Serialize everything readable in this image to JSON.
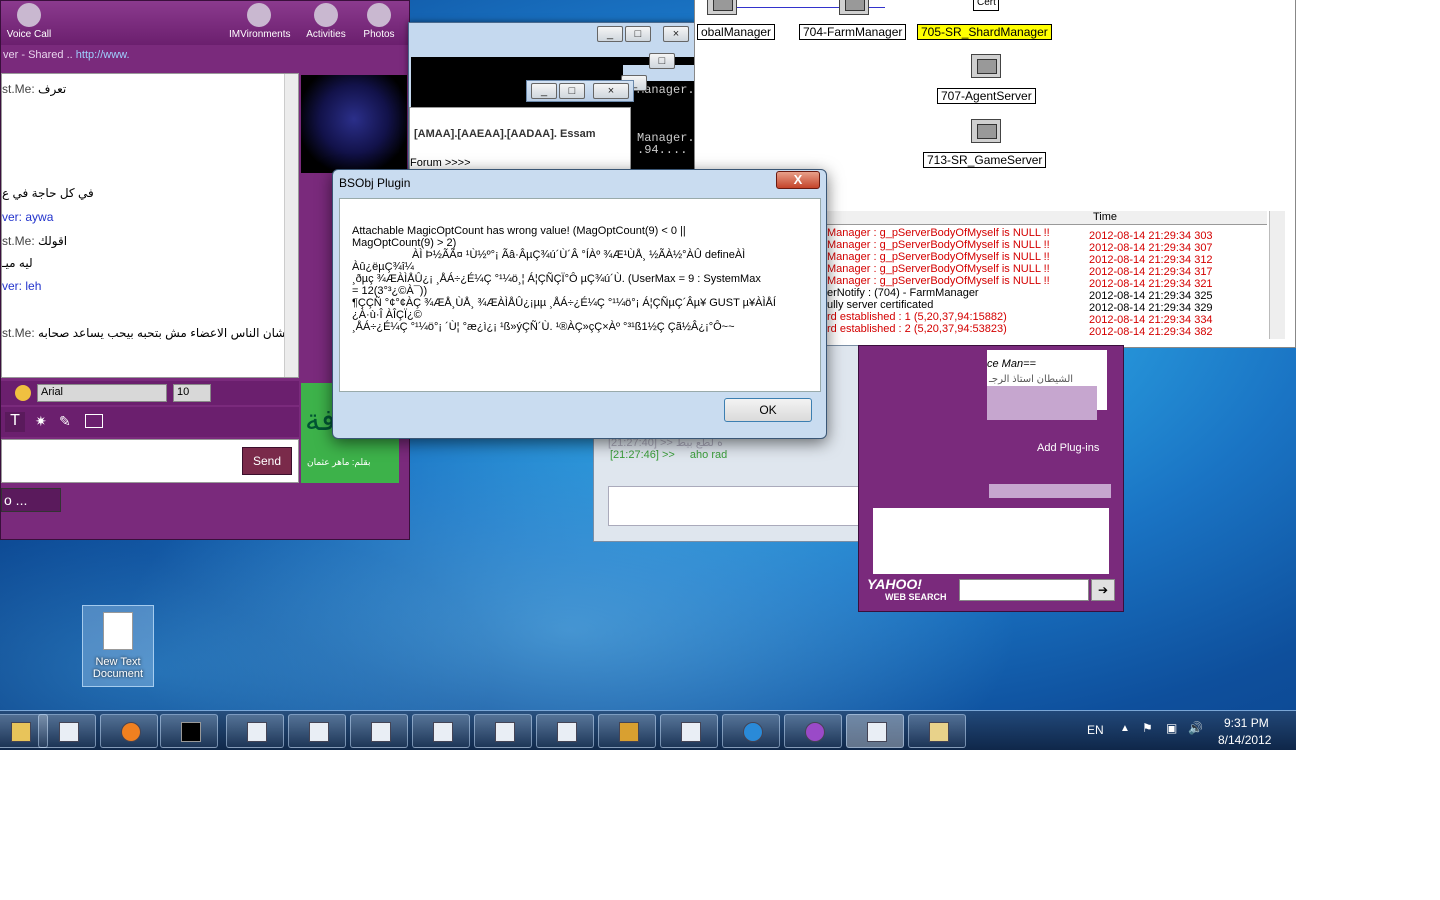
{
  "yahoo": {
    "toolbar": [
      "Voice Call",
      "IMVironments",
      "Activities",
      "Photos"
    ],
    "share_prefix": "ver",
    "share_text": "- Shared .. ",
    "share_link": "http://www.",
    "chat_lines": [
      {
        "user": "st.Me:",
        "text": "تعرف"
      },
      {
        "user": "",
        "text": "في كل حاجة في ع"
      },
      {
        "user": "ver:",
        "text": "aywa"
      },
      {
        "user": "st.Me:",
        "text": "اقولك"
      },
      {
        "user": "",
        "text": "ليه ميـ"
      },
      {
        "user": "ver:",
        "text": "leh"
      },
      {
        "user": "st.Me:",
        "text": "علشان الناس الاعضاء مش بتحبه بيحب يساعد صحابه"
      }
    ],
    "font_name": "Arial",
    "font_size": "10",
    "send_label": "Send",
    "more_label": "o ...",
    "ad_text": "بمعرفة",
    "ad_sub": "بقلم: ماهر عثمان"
  },
  "console": {
    "line1": "Manager.",
    "line2": "Manager.",
    "line3": ".94...."
  },
  "bg_window": {
    "text1": "[AMAA].[AAEAA].[AADAA]. Essam",
    "text2": "Forum >>>>"
  },
  "server_manager": {
    "nodes": [
      "obalManager",
      "704-FarmManager",
      "705-SR_ShardManager",
      "707-AgentServer",
      "713-SR_GameServer"
    ],
    "cert_label": "Cert",
    "time_header": "Time",
    "logs": [
      {
        "msg": "Manager : g_pServerBodyOfMyself is NULL !!",
        "time": "2012-08-14 21:29:34 303",
        "level": "error"
      },
      {
        "msg": "Manager : g_pServerBodyOfMyself is NULL !!",
        "time": "2012-08-14 21:29:34 307",
        "level": "error"
      },
      {
        "msg": "Manager : g_pServerBodyOfMyself is NULL !!",
        "time": "2012-08-14 21:29:34 312",
        "level": "error"
      },
      {
        "msg": "Manager : g_pServerBodyOfMyself is NULL !!",
        "time": "2012-08-14 21:29:34 317",
        "level": "error"
      },
      {
        "msg": "Manager : g_pServerBodyOfMyself is NULL !!",
        "time": "2012-08-14 21:29:34 321",
        "level": "error"
      },
      {
        "msg": "erNotify : (704) - FarmManager",
        "time": "2012-08-14 21:29:34 325",
        "level": "info"
      },
      {
        "msg": "ully server certificated",
        "time": "2012-08-14 21:29:34 329",
        "level": "info"
      },
      {
        "msg": "rd established : 1 (5,20,37,94:15882)",
        "time": "2012-08-14 21:29:34 334",
        "level": "error"
      },
      {
        "msg": "rd established : 2 (5,20,37,94:53823)",
        "time": "2012-08-14 21:29:34 382",
        "level": "error"
      }
    ]
  },
  "other_chat": {
    "ts1": "[21:27:46] >>",
    "msg1": "aho rad",
    "ts0": "[21:27:40] >>",
    "msg0": "ه لطع بيط",
    "name": "ce Man==",
    "sub": "الشيطان استاذ الرجـ"
  },
  "yahoo_panel": {
    "add_plugins": "Add Plug-ins",
    "logo": "YAHOO!",
    "search_label": "WEB SEARCH"
  },
  "dialog": {
    "title": "BSObj Plugin",
    "close": "X",
    "message": [
      "Attachable MagicOptCount has wrong value! (MagOptCount(9) < 0 ||",
      "MagOptCount(9) > 2)",
      "ÀÌ Þ½ÃÃ¤ ¹Ù½º°¡ Ãâ·ÂµÇ¾ú´Ù´Â °ÍÀº ¾Æ¹ÙÅ¸ ½ÃÀ½°ÀÛ defineÀÌ",
      "Àû¿ëµÇ¾î¼­",
      "¸ðµç ¾ÆÀÌÅÛ¿¡ ¸ÅÁ÷¿É¼Ç °¹¼ö¸¦ Á¦ÇÑÇÏ°Ô µÇ¾ú´Ù. (UserMax = 9 : SystemMax",
      "= 12(3°³¿©À¯))",
      "¶ÇÇÑ °¢°¢ÀÇ ¾ÆÅ¸ÙÅ¸ ¾ÆÀÌÅÛ¿¡µµ ¸ÅÁ÷¿É¼Ç °¹¼ö°¡ Á¦ÇÑµÇ´Âµ¥ GUST µ¥ÀÌÅÍ",
      "¿À·ù·Î ÀÎÇÏ¿©",
      "¸ÅÁ÷¿É¼Ç °¹¼ö°¡ ´Ù¦ °æ¿ì¿¡ ¹ß»ýÇÑ´Ù. ¹®ÀÇ»çÇ×Àº °³¹ß1½Ç Çã½Â¿¡°Ô~~"
    ],
    "ok_label": "OK"
  },
  "desktop_icon": {
    "line1": "New Text",
    "line2": "Document"
  },
  "tray": {
    "lang": "EN",
    "time": "9:31 PM",
    "date": "8/14/2012"
  }
}
